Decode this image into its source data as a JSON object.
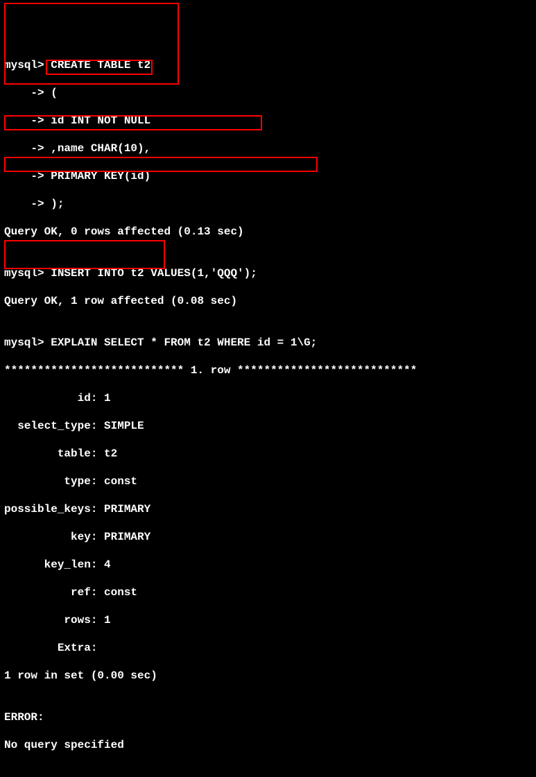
{
  "lines": {
    "l1": "mysql> CREATE TABLE t2",
    "l2": "    -> (",
    "l3": "    -> id INT NOT NULL",
    "l4": "    -> ,name CHAR(10),",
    "l5": "    -> PRIMARY KEY(id)",
    "l6": "    -> );",
    "l7": "Query OK, 0 rows affected (0.13 sec)",
    "l8": "",
    "l9": "mysql> INSERT INTO t2 VALUES(1,'QQQ');",
    "l10": "Query OK, 1 row affected (0.08 sec)",
    "l11": "",
    "l12": "mysql> EXPLAIN SELECT * FROM t2 WHERE id = 1\\G;",
    "l13": "*************************** 1. row ***************************",
    "l14": "           id: 1",
    "l15": "  select_type: SIMPLE",
    "l16": "        table: t2",
    "l17": "         type: const",
    "l18": "possible_keys: PRIMARY",
    "l19": "          key: PRIMARY",
    "l20": "      key_len: 4",
    "l21": "          ref: const",
    "l22": "         rows: 1",
    "l23": "        Extra:",
    "l24": "1 row in set (0.00 sec)",
    "l25": "",
    "l26": "ERROR:",
    "l27": "No query specified"
  },
  "highlights": {
    "box1_desc": "create-table-statement",
    "box2_desc": "primary-key-clause",
    "box3_desc": "insert-statement",
    "box4_desc": "explain-statement",
    "box5_desc": "possible-keys-output"
  }
}
